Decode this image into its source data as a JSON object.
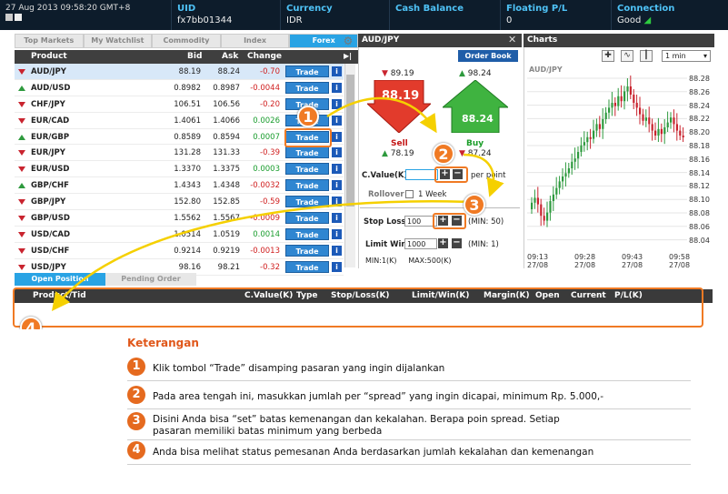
{
  "topbar": {
    "datetime": "27 Aug 2013 09:58:20 GMT+8",
    "uid_label": "UID",
    "uid_value": "fx7bb01344",
    "currency_label": "Currency",
    "currency_value": "IDR",
    "cash_label": "Cash Balance",
    "cash_value": "",
    "floating_label": "Floating P/L",
    "floating_value": "0",
    "connection_label": "Connection",
    "connection_value": "Good"
  },
  "tabs": [
    "Top Markets",
    "My Watchlist",
    "Commodity",
    "Index",
    "Forex"
  ],
  "active_tab": "Forex",
  "table": {
    "headers": {
      "product": "Product",
      "bid": "Bid",
      "ask": "Ask",
      "change": "Change"
    },
    "trade_label": "Trade",
    "info_label": "i",
    "rows": [
      {
        "product": "AUD/JPY",
        "bid": "88.19",
        "ask": "88.24",
        "change": "-0.70",
        "dir": "down"
      },
      {
        "product": "AUD/USD",
        "bid": "0.8982",
        "ask": "0.8987",
        "change": "-0.0044",
        "dir": "up"
      },
      {
        "product": "CHF/JPY",
        "bid": "106.51",
        "ask": "106.56",
        "change": "-0.20",
        "dir": "down"
      },
      {
        "product": "EUR/CAD",
        "bid": "1.4061",
        "ask": "1.4066",
        "change": "0.0026",
        "dir": "down"
      },
      {
        "product": "EUR/GBP",
        "bid": "0.8589",
        "ask": "0.8594",
        "change": "0.0007",
        "dir": "up"
      },
      {
        "product": "EUR/JPY",
        "bid": "131.28",
        "ask": "131.33",
        "change": "-0.39",
        "dir": "down"
      },
      {
        "product": "EUR/USD",
        "bid": "1.3370",
        "ask": "1.3375",
        "change": "0.0003",
        "dir": "down"
      },
      {
        "product": "GBP/CHF",
        "bid": "1.4343",
        "ask": "1.4348",
        "change": "-0.0032",
        "dir": "up"
      },
      {
        "product": "GBP/JPY",
        "bid": "152.80",
        "ask": "152.85",
        "change": "-0.59",
        "dir": "down"
      },
      {
        "product": "GBP/USD",
        "bid": "1.5562",
        "ask": "1.5567",
        "change": "-0.0009",
        "dir": "down"
      },
      {
        "product": "USD/CAD",
        "bid": "1.0514",
        "ask": "1.0519",
        "change": "0.0014",
        "dir": "down"
      },
      {
        "product": "USD/CHF",
        "bid": "0.9214",
        "ask": "0.9219",
        "change": "-0.0013",
        "dir": "down"
      },
      {
        "product": "USD/JPY",
        "bid": "98.16",
        "ask": "98.21",
        "change": "-0.32",
        "dir": "down"
      }
    ]
  },
  "trade_panel": {
    "title": "AUD/JPY",
    "order_book": "Order Book",
    "sell_top": "89.19",
    "sell_price": "88.19",
    "sell_label": "Sell",
    "sell_bottom": "78.19",
    "buy_top": "98.24",
    "buy_price": "88.24",
    "buy_label": "Buy",
    "buy_bottom": "87.24",
    "cvalue_label": "C.Value(K)",
    "cvalue_value": "",
    "per_point": "per point",
    "rollover_label": "Rollover",
    "rollover_option": "1 Week",
    "stoploss_label": "Stop Loss",
    "stoploss_value": "100",
    "stoploss_min": "(MIN: 50)",
    "limitwin_label": "Limit Win",
    "limitwin_value": "1000",
    "limitwin_min": "(MIN: 1)",
    "minmax": "MIN:1(K)     MAX:500(K)",
    "plus": "+",
    "minus": "−"
  },
  "chart": {
    "panel_title": "Charts",
    "symbol": "AUD/JPY",
    "timeframe": "1 min",
    "y_ticks": [
      "88.28",
      "88.26",
      "88.24",
      "88.22",
      "88.20",
      "88.18",
      "88.16",
      "88.14",
      "88.12",
      "88.10",
      "88.08",
      "88.06",
      "88.04"
    ],
    "x_ticks": [
      {
        "t": "09:13",
        "d": "27/08"
      },
      {
        "t": "09:28",
        "d": "27/08"
      },
      {
        "t": "09:43",
        "d": "27/08"
      },
      {
        "t": "09:58",
        "d": "27/08"
      }
    ],
    "up_color": "#2e9a3e",
    "down_color": "#c9242f"
  },
  "orders": {
    "tab_open": "Open Position",
    "tab_pending": "Pending Order",
    "columns": [
      "Product/Tid",
      "C.Value(K)",
      "Type",
      "Stop/Loss(K)",
      "Limit/Win(K)",
      "Margin(K)",
      "Open",
      "Current",
      "P/L(K)"
    ]
  },
  "badges": [
    "1",
    "2",
    "3",
    "4"
  ],
  "legend": {
    "title": "Keterangan",
    "items": [
      {
        "n": "1",
        "text": "Klik tombol “Trade” disamping pasaran yang ingin dijalankan"
      },
      {
        "n": "2",
        "text": "Pada area tengah ini, masukkan jumlah per “spread” yang ingin dicapai, minimum Rp. 5.000,-"
      },
      {
        "n": "3",
        "text": "Disini Anda bisa “set” batas kemenangan dan kekalahan. Berapa poin spread. Setiap pasaran memiliki batas minimum yang berbeda"
      },
      {
        "n": "4",
        "text": "Anda bisa melihat status pemesanan Anda berdasarkan jumlah kekalahan dan kemenangan"
      }
    ]
  },
  "colors": {
    "accent": "#29a3e4",
    "highlight": "#f07a24",
    "trade_button": "#2f86d1"
  }
}
